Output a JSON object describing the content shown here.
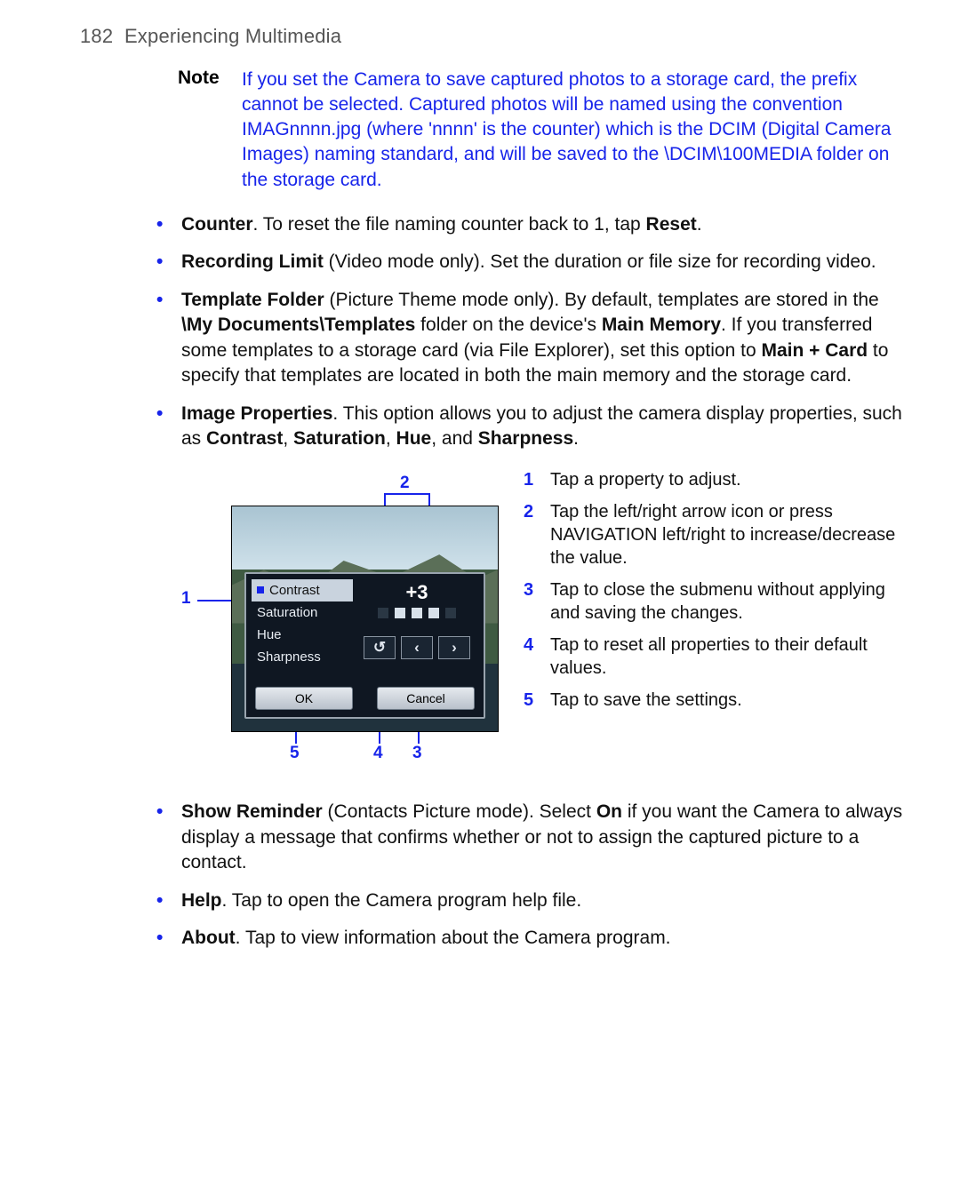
{
  "header": {
    "page_no": "182",
    "chapter": "Experiencing Multimedia"
  },
  "note": {
    "label": "Note",
    "text": "If you set the Camera to save captured photos to a storage card, the prefix cannot be selected. Captured photos will be named using the convention IMAGnnnn.jpg (where 'nnnn' is the counter) which is the DCIM (Digital Camera Images) naming standard, and will be saved to the \\DCIM\\100MEDIA folder on the storage card."
  },
  "bullets_top": {
    "counter": {
      "b": "Counter",
      "t": ". To reset the file naming counter back to 1, tap ",
      "b2": "Reset",
      "t2": "."
    },
    "reclimit": {
      "b": "Recording Limit",
      "t": " (Video mode only). Set the duration or file size for recording video."
    },
    "template": {
      "b": "Template Folder",
      "t": " (Picture Theme mode only). By default, templates are stored in the ",
      "b2": "\\My Documents\\Templates",
      "t2": " folder on the device's ",
      "b3": "Main Memory",
      "t3": ". If you transferred some templates to a storage card (via File Explorer), set this option to ",
      "b4": "Main + Card",
      "t4": " to specify that templates are located in both the main memory and the storage card."
    },
    "imgprops": {
      "b": "Image Properties",
      "t": ". This option allows you to adjust the camera display properties, such as ",
      "b2": "Contrast",
      "c": ", ",
      "b3": "Saturation",
      "c2": ", ",
      "b4": "Hue",
      "t2": ", and ",
      "b5": "Sharpness",
      "t3": "."
    }
  },
  "screenshot": {
    "props": [
      "Contrast",
      "Saturation",
      "Hue",
      "Sharpness"
    ],
    "selected_index": 0,
    "value_text": "+3",
    "arrow_reset": "↺",
    "arrow_left": "‹",
    "arrow_right": "›",
    "ok": "OK",
    "cancel": "Cancel"
  },
  "callouts": {
    "n1": "1",
    "n2": "2",
    "n3": "3",
    "n4": "4",
    "n5": "5"
  },
  "legend": {
    "i1": {
      "n": "1",
      "t": "Tap a property to adjust."
    },
    "i2": {
      "n": "2",
      "t": "Tap the left/right arrow icon or press NAVIGATION left/right to increase/decrease the value."
    },
    "i3": {
      "n": "3",
      "t": "Tap to close the submenu without applying and saving the changes."
    },
    "i4": {
      "n": "4",
      "t": "Tap to reset all properties to their default values."
    },
    "i5": {
      "n": "5",
      "t": "Tap to save the settings."
    }
  },
  "bullets_bottom": {
    "reminder": {
      "b": "Show Reminder",
      "t": " (Contacts Picture mode). Select ",
      "b2": "On",
      "t2": " if you want the Camera to always display a message that confirms whether or not to assign the captured picture to a contact."
    },
    "help": {
      "b": "Help",
      "t": ". Tap to open the Camera program help file."
    },
    "about": {
      "b": "About",
      "t": ". Tap to view information about the Camera program."
    }
  }
}
